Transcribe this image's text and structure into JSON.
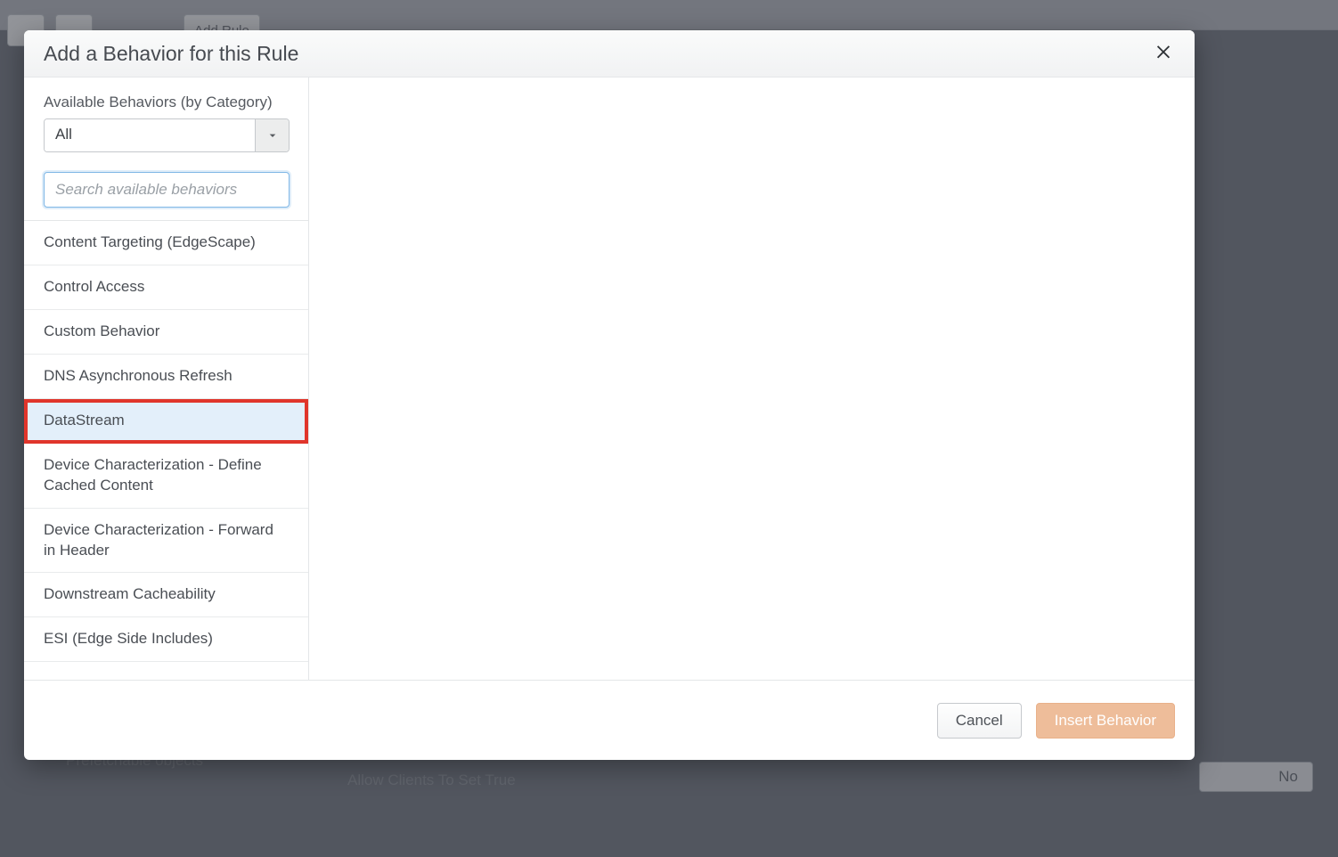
{
  "modal": {
    "title": "Add a Behavior for this Rule",
    "filters_label": "Available Behaviors (by Category)",
    "category_selected": "All",
    "search_placeholder": "Search available behaviors",
    "cancel_label": "Cancel",
    "insert_label": "Insert Behavior"
  },
  "behaviors": [
    {
      "label": "Content Targeting (EdgeScape)",
      "highlighted": false
    },
    {
      "label": "Control Access",
      "highlighted": false
    },
    {
      "label": "Custom Behavior",
      "highlighted": false
    },
    {
      "label": "DNS Asynchronous Refresh",
      "highlighted": false
    },
    {
      "label": "DataStream",
      "highlighted": true
    },
    {
      "label": "Device Characterization - Define Cached Content",
      "highlighted": false
    },
    {
      "label": "Device Characterization - Forward in Header",
      "highlighted": false
    },
    {
      "label": "Downstream Cacheability",
      "highlighted": false
    },
    {
      "label": "ESI (Edge Side Includes)",
      "highlighted": false
    }
  ],
  "background": {
    "sidebar_item": "Prefetchable objects",
    "field_label": "Allow Clients To Set True",
    "toggle_value": "No",
    "add_rule_btn": "Add Rule"
  }
}
